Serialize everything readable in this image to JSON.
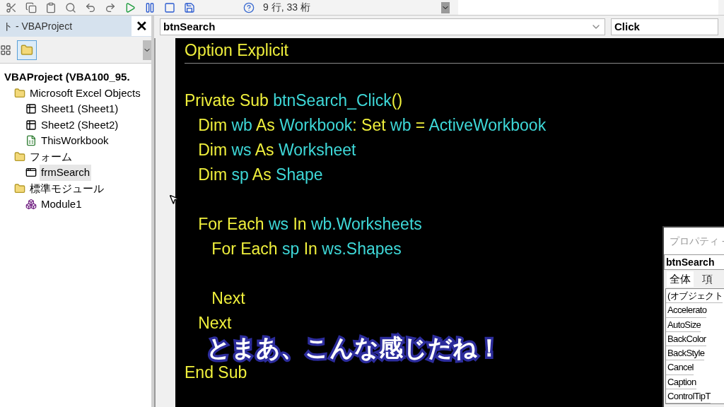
{
  "toolbar": {
    "status": "9 行, 33 桁"
  },
  "project_explorer": {
    "title": "ト - VBAProject",
    "close": "✕",
    "tree": [
      {
        "label": "VBAProject (VBA100_95.",
        "kind": "project",
        "selected": false,
        "children": [
          {
            "label": "Microsoft Excel Objects",
            "kind": "folder",
            "selected": false,
            "children": [
              {
                "label": "Sheet1 (Sheet1)",
                "kind": "sheet",
                "selected": false
              },
              {
                "label": "Sheet2 (Sheet2)",
                "kind": "sheet",
                "selected": false
              },
              {
                "label": "ThisWorkbook",
                "kind": "workbook",
                "selected": false
              }
            ]
          },
          {
            "label": "フォーム",
            "kind": "folder",
            "selected": false,
            "children": [
              {
                "label": "frmSearch",
                "kind": "form",
                "selected": true
              }
            ]
          },
          {
            "label": "標準モジュール",
            "kind": "folder",
            "selected": false,
            "children": [
              {
                "label": "Module1",
                "kind": "module",
                "selected": false
              }
            ]
          }
        ]
      }
    ]
  },
  "code_window": {
    "object": "btnSearch",
    "procedure": "Click",
    "sections": [
      {
        "lines": [
          {
            "kind": "code",
            "segments": [
              {
                "kind": "keyword",
                "text": "Option Explicit"
              }
            ]
          }
        ]
      },
      {
        "lines": [
          {
            "kind": "blank"
          },
          {
            "kind": "code",
            "segments": [
              {
                "kind": "keyword",
                "text": "Private Sub "
              },
              {
                "kind": "identifier",
                "text": "btnSearch_Click"
              },
              {
                "kind": "keyword",
                "text": "()"
              }
            ]
          },
          {
            "kind": "code",
            "segments": [
              {
                "kind": "keyword",
                "text": "   Dim "
              },
              {
                "kind": "identifier",
                "text": "wb"
              },
              {
                "kind": "keyword",
                "text": " As "
              },
              {
                "kind": "identifier",
                "text": "Workbook"
              },
              {
                "kind": "keyword",
                "text": ": Set "
              },
              {
                "kind": "identifier",
                "text": "wb"
              },
              {
                "kind": "keyword",
                "text": " = "
              },
              {
                "kind": "identifier",
                "text": "ActiveWorkbook"
              }
            ]
          },
          {
            "kind": "code",
            "segments": [
              {
                "kind": "keyword",
                "text": "   Dim "
              },
              {
                "kind": "identifier",
                "text": "ws"
              },
              {
                "kind": "keyword",
                "text": " As "
              },
              {
                "kind": "identifier",
                "text": "Worksheet"
              }
            ]
          },
          {
            "kind": "code",
            "segments": [
              {
                "kind": "keyword",
                "text": "   Dim "
              },
              {
                "kind": "identifier",
                "text": "sp"
              },
              {
                "kind": "keyword",
                "text": " As "
              },
              {
                "kind": "identifier",
                "text": "Shape"
              }
            ]
          },
          {
            "kind": "blank"
          },
          {
            "kind": "code",
            "segments": [
              {
                "kind": "keyword",
                "text": "   For Each "
              },
              {
                "kind": "identifier",
                "text": "ws"
              },
              {
                "kind": "keyword",
                "text": " In "
              },
              {
                "kind": "identifier",
                "text": "wb.Worksheets"
              }
            ]
          },
          {
            "kind": "code",
            "segments": [
              {
                "kind": "keyword",
                "text": "      For Each "
              },
              {
                "kind": "identifier",
                "text": "sp"
              },
              {
                "kind": "keyword",
                "text": " In "
              },
              {
                "kind": "identifier",
                "text": "ws.Shapes"
              }
            ]
          },
          {
            "kind": "blank"
          },
          {
            "kind": "code",
            "segments": [
              {
                "kind": "keyword",
                "text": "      Next"
              }
            ]
          },
          {
            "kind": "code",
            "segments": [
              {
                "kind": "keyword",
                "text": "   Next"
              }
            ]
          },
          {
            "kind": "blank"
          },
          {
            "kind": "code",
            "segments": [
              {
                "kind": "keyword",
                "text": "End Sub"
              }
            ]
          }
        ]
      }
    ]
  },
  "properties": {
    "title": "プロパティ -",
    "object": "btnSearch",
    "tabs": [
      {
        "label": "全体",
        "selected": true
      },
      {
        "label": "項",
        "selected": false
      }
    ],
    "rows": [
      "(オブジェクト",
      "Accelerato",
      "AutoSize",
      "BackColor",
      "BackStyle",
      "Cancel",
      "Caption",
      "ControlTipT"
    ]
  },
  "subtitle": "とまあ、こんな感じだね！"
}
